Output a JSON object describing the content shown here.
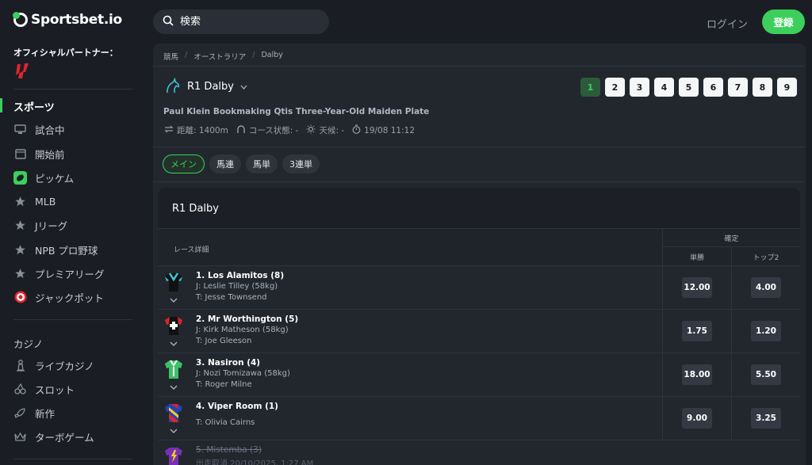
{
  "brand": {
    "name": "Sportsbet.io"
  },
  "sidebar": {
    "partner_label": "オフィシャルパートナー：",
    "sports_title": "スポーツ",
    "items": [
      {
        "label": "試合中",
        "icon": "monitor-icon"
      },
      {
        "label": "開始前",
        "icon": "calendar-icon"
      },
      {
        "label": "ピッケム",
        "icon": "pickem-icon"
      },
      {
        "label": "MLB",
        "icon": "star-icon"
      },
      {
        "label": "Jリーグ",
        "icon": "star-icon"
      },
      {
        "label": "NPB プロ野球",
        "icon": "star-icon"
      },
      {
        "label": "プレミアリーグ",
        "icon": "star-icon"
      },
      {
        "label": "ジャックポット",
        "icon": "target-icon"
      }
    ],
    "casino_title": "カジノ",
    "casino_items": [
      {
        "label": "ライブカジノ",
        "icon": "chess-icon"
      },
      {
        "label": "スロット",
        "icon": "cherries-icon"
      },
      {
        "label": "新作",
        "icon": "rocket-icon"
      },
      {
        "label": "ターボゲーム",
        "icon": "crown-icon"
      }
    ]
  },
  "header": {
    "search_placeholder": "検索",
    "login_label": "ログイン",
    "register_label": "登録"
  },
  "breadcrumb": [
    "競馬",
    "オーストラリア",
    "Dalby"
  ],
  "race": {
    "title": "R1 Dalby",
    "tabs": [
      "1",
      "2",
      "3",
      "4",
      "5",
      "6",
      "7",
      "8",
      "9"
    ],
    "active_tab": "1",
    "subtitle": "Paul Klein Bookmaking Qtis Three-Year-Old Maiden Plate",
    "distance": "距離: 1400m",
    "course": "コース状態: -",
    "weather": "天候: -",
    "start_time": "19/08 11:12"
  },
  "bet_tabs": [
    "メイン",
    "馬連",
    "馬単",
    "3連単"
  ],
  "card": {
    "title": "R1 Dalby",
    "header_detail": "レース詳細",
    "header_confirm": "確定",
    "header_win": "単勝",
    "header_place": "トップ2"
  },
  "runners": [
    {
      "name": "1. Los Alamitos (8)",
      "jockey": "J: Leslie Tilley (58kg)",
      "trainer": "T: Jesse Townsend",
      "win": "12.00",
      "place": "4.00"
    },
    {
      "name": "2. Mr Worthington (5)",
      "jockey": "J: Kirk Matheson (58kg)",
      "trainer": "T: Joe Gleeson",
      "win": "1.75",
      "place": "1.20"
    },
    {
      "name": "3. Nasiron (4)",
      "jockey": "J: Nozi Tomizawa (58kg)",
      "trainer": "T: Roger Milne",
      "win": "18.00",
      "place": "5.50"
    },
    {
      "name": "4. Viper Room (1)",
      "jockey": "",
      "trainer": "T: Olivia Cairns",
      "win": "9.00",
      "place": "3.25"
    },
    {
      "name": "5. Mistemba (3)",
      "jockey": "出走取消 20/10/2025, 1:27 AM",
      "trainer": "",
      "win": "",
      "place": ""
    }
  ],
  "colors": {
    "accent": "#3ccf5c",
    "background": "#1a1e24",
    "panel": "#22272e"
  }
}
